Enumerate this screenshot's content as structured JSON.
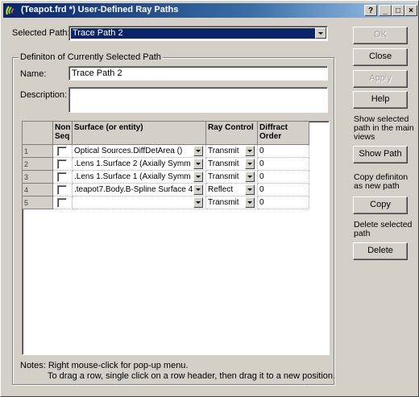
{
  "window": {
    "title": "(Teapot.frd *) User-Defined Ray Paths",
    "help_btn": "?",
    "min_btn": "_",
    "max_btn": "□",
    "close_btn": "×"
  },
  "selected_path": {
    "label": "Selected Path:",
    "value": "Trace Path 2"
  },
  "group": {
    "title": "Definiton of Currently Selected Path"
  },
  "name": {
    "label": "Name:",
    "value": "Trace Path 2"
  },
  "description": {
    "label": "Description:",
    "value": ""
  },
  "grid": {
    "headers": {
      "nonseq": "Non Seq",
      "surface": "Surface (or entity)",
      "ray": "Ray Control",
      "diffract": "Diffract Order"
    },
    "rows": [
      {
        "num": "1",
        "surface": "Optical Sources.DiffDetArea   ()",
        "ray": "Transmit",
        "order": "0"
      },
      {
        "num": "2",
        "surface": ".Lens 1.Surface 2   (Axially Symm",
        "ray": "Transmit",
        "order": "0"
      },
      {
        "num": "3",
        "surface": ".Lens 1.Surface 1   (Axially Symm",
        "ray": "Transmit",
        "order": "0"
      },
      {
        "num": "4",
        "surface": ".teapot7.Body.B-Spline Surface 4",
        "ray": "Reflect",
        "order": "0"
      },
      {
        "num": "5",
        "surface": "",
        "ray": "Transmit",
        "order": "0"
      }
    ]
  },
  "notes": {
    "line1": "Notes:  Right mouse-click for pop-up menu.",
    "line2": "To drag a row,  single click on a row header, then drag it to a new position."
  },
  "buttons": {
    "ok": "OK",
    "close": "Close",
    "apply": "Apply",
    "help": "Help",
    "show_caption": "Show selected path in the main views",
    "show_path": "Show Path",
    "copy_caption": "Copy definiton as new path",
    "copy": "Copy",
    "delete_caption": "Delete selected path",
    "delete": "Delete"
  }
}
